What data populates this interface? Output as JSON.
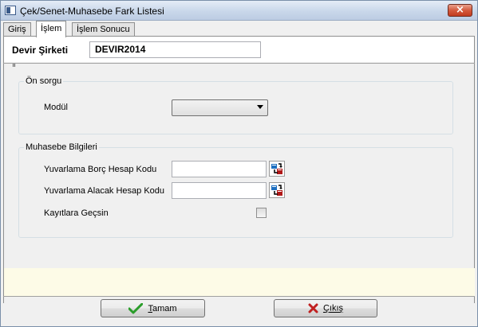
{
  "window": {
    "title": "Çek/Senet-Muhasebe Fark Listesi",
    "close_symbol": "×"
  },
  "tabs": [
    {
      "label": "Giriş",
      "active": false
    },
    {
      "label": "İşlem",
      "active": true
    },
    {
      "label": "İşlem Sonucu",
      "active": false
    }
  ],
  "company": {
    "label": "Devir Şirketi",
    "value": "DEVIR2014"
  },
  "on_sorgu": {
    "legend": "Ön sorgu",
    "modul_label": "Modül",
    "modul_value": ""
  },
  "muhasebe": {
    "legend": "Muhasebe Bilgileri",
    "borc_label": "Yuvarlama Borç Hesap Kodu",
    "borc_value": "",
    "alacak_label": "Yuvarlama Alacak Hesap Kodu",
    "alacak_value": "",
    "kayit_label": "Kayıtlara Geçsin",
    "kayit_checked": false
  },
  "buttons": {
    "ok_first": "T",
    "ok_rest": "amam",
    "cancel_first": "Ç",
    "cancel_rest": "ıkış"
  },
  "icons": {
    "window": "window-icon",
    "close": "close-icon",
    "lookup": "lookup-icon",
    "ok": "checkmark-icon",
    "cancel": "x-icon"
  },
  "colors": {
    "ok_green": "#2a9d2a",
    "cancel_red": "#c02020",
    "status_band": "#fdfbe7"
  }
}
